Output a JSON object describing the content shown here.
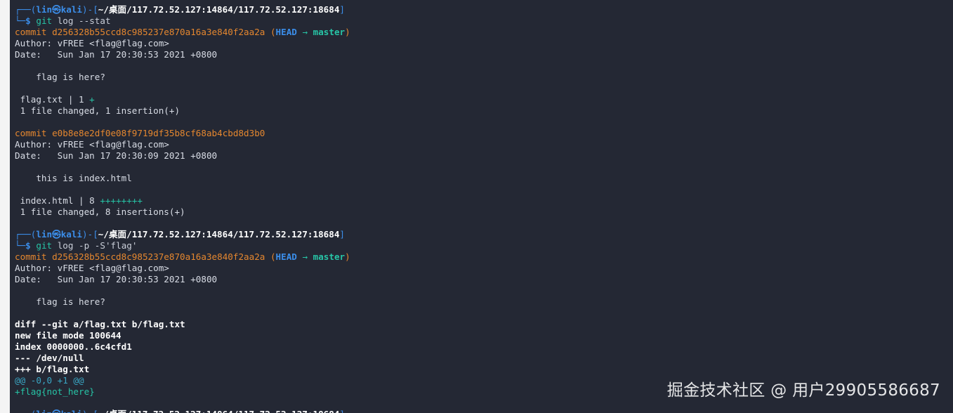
{
  "prompt1": {
    "corner_top": "┌──(",
    "user": "lin",
    "at": "㉿",
    "host": "kali",
    "mid": ")-[",
    "path": "~/桌面/117.72.52.127:14864/117.72.52.127:18684",
    "end": "]",
    "corner_bottom": "└─",
    "symbol": "$",
    "cmd": "git",
    "args": "log --stat"
  },
  "log1": {
    "commit1_hash": "commit d256328b55ccd8c985237e870a16a3e840f2aa2a",
    "paren_open": " (",
    "head": "HEAD",
    "arrow": " → ",
    "branch": "master",
    "paren_close": ")",
    "author1": "Author: vFREE <flag@flag.com>",
    "date1": "Date:   Sun Jan 17 20:30:53 2021 +0800",
    "msg1": "    flag is here?",
    "stat1_file": " flag.txt | 1 ",
    "stat1_plus": "+",
    "summary1": " 1 file changed, 1 insertion(+)",
    "commit2_hash": "commit e0b8e8e2df0e08f9719df35b8cf68ab4cbd8d3b0",
    "author2": "Author: vFREE <flag@flag.com>",
    "date2": "Date:   Sun Jan 17 20:30:09 2021 +0800",
    "msg2": "    this is index.html",
    "stat2_file": " index.html | 8 ",
    "stat2_plus": "++++++++",
    "summary2": " 1 file changed, 8 insertions(+)"
  },
  "prompt2": {
    "args": "log -p -S'flag'"
  },
  "log2": {
    "commit_hash": "commit d256328b55ccd8c985237e870a16a3e840f2aa2a",
    "author": "Author: vFREE <flag@flag.com>",
    "date": "Date:   Sun Jan 17 20:30:53 2021 +0800",
    "msg": "    flag is here?",
    "diff_header": "diff --git a/flag.txt b/flag.txt",
    "new_mode": "new file mode 100644",
    "index": "index 0000000..6c4cfd1",
    "minus_file": "--- /dev/null",
    "plus_file": "+++ b/flag.txt",
    "hunk": "@@ -0,0 +1 @@",
    "added_line": "+flag{not_here}"
  },
  "watermark": "掘金技术社区 @ 用户29905586687"
}
